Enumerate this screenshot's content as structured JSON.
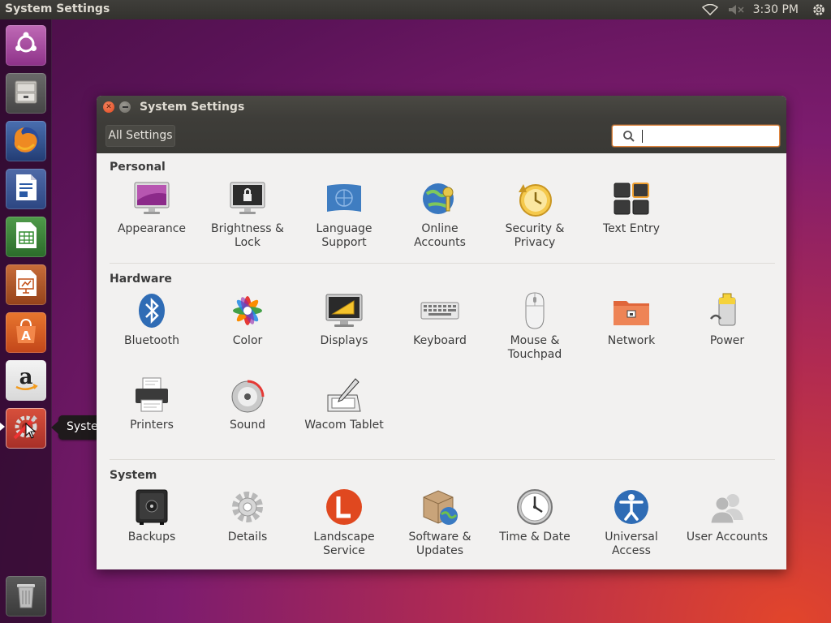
{
  "top_panel": {
    "app_title": "System Settings",
    "clock": "3:30 PM",
    "indicators": [
      "wifi-icon",
      "volume-muted-icon",
      "gear-icon"
    ]
  },
  "launcher": {
    "items": [
      {
        "name": "ubuntu-dash",
        "icon": "ubuntu-logo-icon"
      },
      {
        "name": "files",
        "icon": "file-cabinet-icon"
      },
      {
        "name": "firefox",
        "icon": "firefox-icon"
      },
      {
        "name": "libreoffice-writer",
        "icon": "writer-icon"
      },
      {
        "name": "libreoffice-calc",
        "icon": "calc-icon"
      },
      {
        "name": "libreoffice-impress",
        "icon": "impress-icon"
      },
      {
        "name": "ubuntu-software",
        "icon": "software-center-icon"
      },
      {
        "name": "amazon",
        "icon": "amazon-icon"
      },
      {
        "name": "system-settings",
        "icon": "system-settings-icon"
      },
      {
        "name": "trash",
        "icon": "trash-icon"
      }
    ],
    "tooltip": "System Settings"
  },
  "window": {
    "title": "System Settings",
    "all_settings_label": "All Settings",
    "search": {
      "value": "",
      "placeholder": ""
    }
  },
  "sections": {
    "personal": {
      "title": "Personal",
      "items": [
        {
          "label": "Appearance",
          "icon": "appearance-icon"
        },
        {
          "label": "Brightness &\nLock",
          "icon": "brightness-lock-icon"
        },
        {
          "label": "Language\nSupport",
          "icon": "language-flag-icon"
        },
        {
          "label": "Online\nAccounts",
          "icon": "online-accounts-icon"
        },
        {
          "label": "Security &\nPrivacy",
          "icon": "security-privacy-icon"
        },
        {
          "label": "Text Entry",
          "icon": "text-entry-icon"
        }
      ]
    },
    "hardware": {
      "title": "Hardware",
      "items": [
        {
          "label": "Bluetooth",
          "icon": "bluetooth-icon"
        },
        {
          "label": "Color",
          "icon": "color-icon"
        },
        {
          "label": "Displays",
          "icon": "displays-icon"
        },
        {
          "label": "Keyboard",
          "icon": "keyboard-icon"
        },
        {
          "label": "Mouse &\nTouchpad",
          "icon": "mouse-icon"
        },
        {
          "label": "Network",
          "icon": "network-icon"
        },
        {
          "label": "Power",
          "icon": "power-battery-icon"
        },
        {
          "label": "Printers",
          "icon": "printer-icon"
        },
        {
          "label": "Sound",
          "icon": "sound-icon"
        },
        {
          "label": "Wacom Tablet",
          "icon": "wacom-tablet-icon"
        }
      ]
    },
    "system": {
      "title": "System",
      "items": [
        {
          "label": "Backups",
          "icon": "backups-safe-icon"
        },
        {
          "label": "Details",
          "icon": "details-gear-icon"
        },
        {
          "label": "Landscape\nService",
          "icon": "landscape-icon"
        },
        {
          "label": "Software &\nUpdates",
          "icon": "software-updates-icon"
        },
        {
          "label": "Time & Date",
          "icon": "clock-icon"
        },
        {
          "label": "Universal\nAccess",
          "icon": "universal-access-icon"
        },
        {
          "label": "User Accounts",
          "icon": "user-accounts-icon"
        }
      ]
    }
  },
  "colors": {
    "accent_orange": "#e0481f",
    "panel_bg": "#3e3d39",
    "window_bg": "#f2f1f0"
  }
}
